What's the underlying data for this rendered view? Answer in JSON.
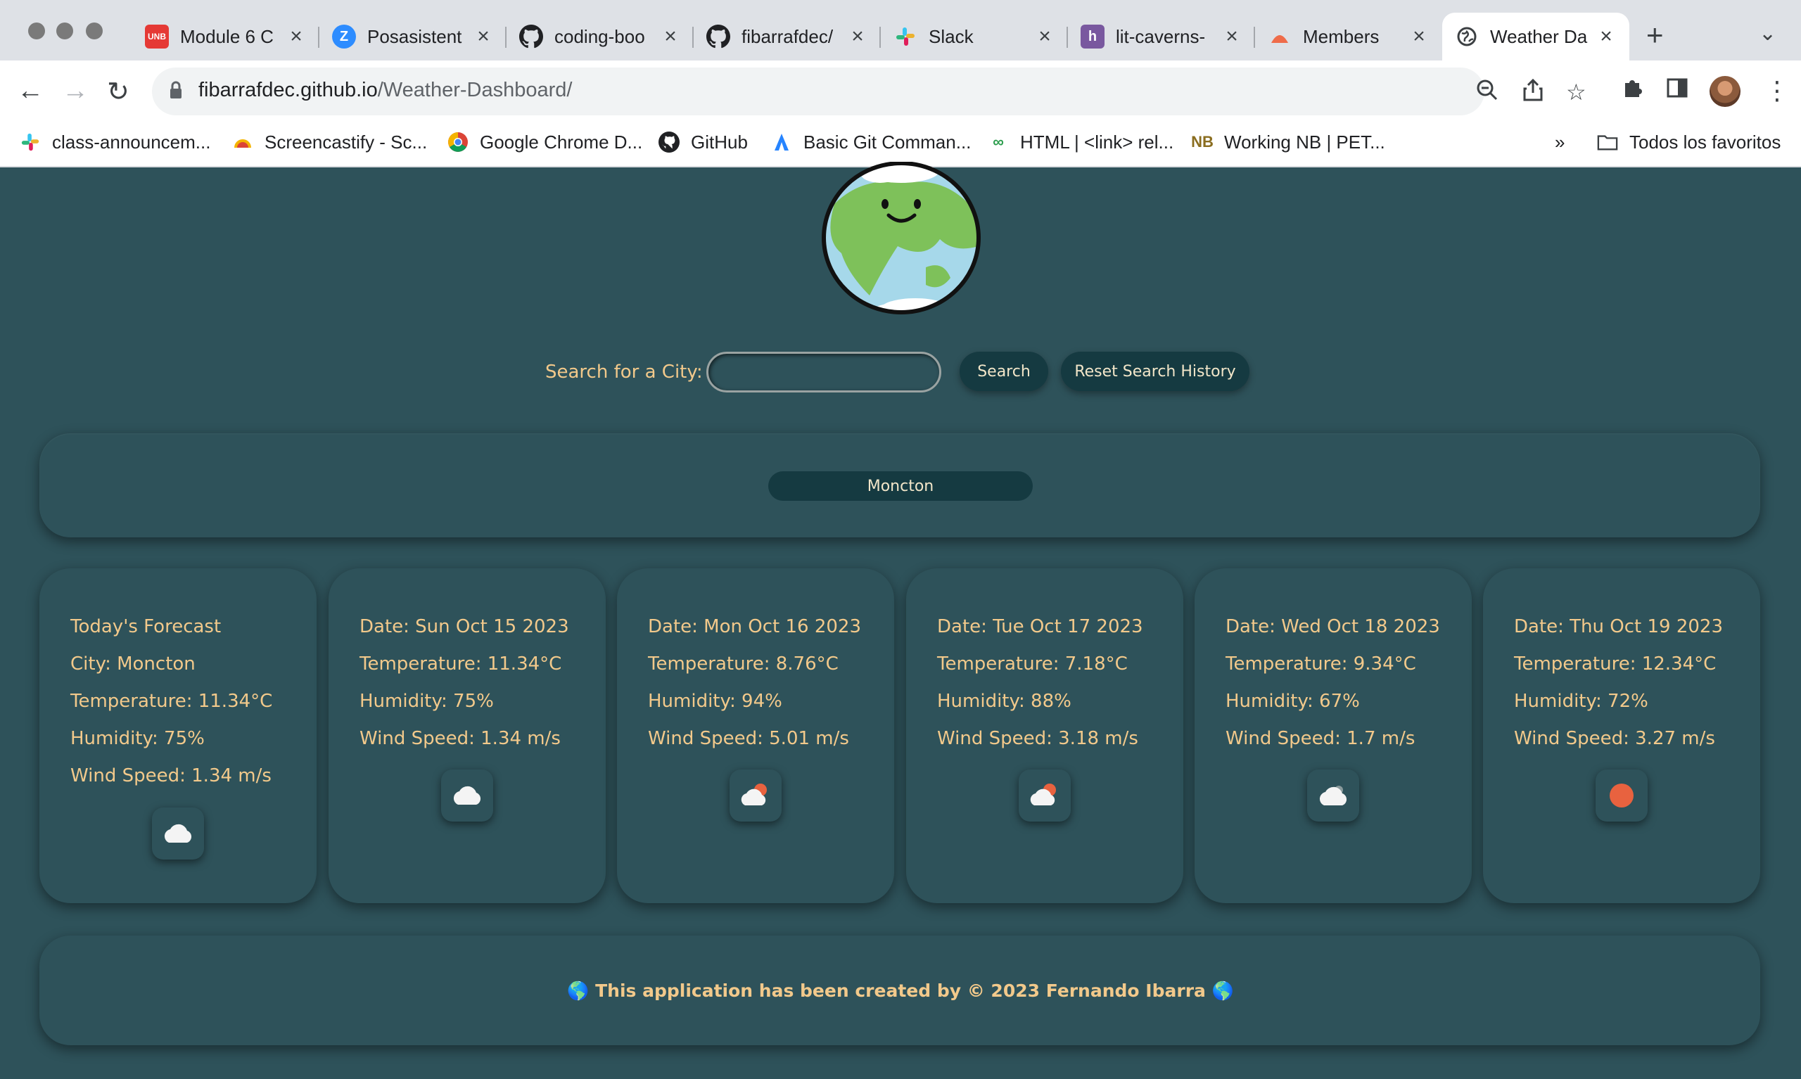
{
  "browser": {
    "tabs": [
      {
        "title": "Module 6 C",
        "favicon": "unb-icon"
      },
      {
        "title": "Posasistent",
        "favicon": "zoom-icon"
      },
      {
        "title": "coding-boo",
        "favicon": "github-icon"
      },
      {
        "title": "fibarrafdec/",
        "favicon": "github-icon"
      },
      {
        "title": "Slack",
        "favicon": "slack-icon"
      },
      {
        "title": "lit-caverns-",
        "favicon": "heroku-icon"
      },
      {
        "title": "Members",
        "favicon": "members-icon"
      },
      {
        "title": "Weather Da",
        "favicon": "globe-icon"
      }
    ],
    "url_host": "fibarrafdec.github.io",
    "url_path": "/Weather-Dashboard/",
    "bookmarks": [
      {
        "label": "class-announcem...",
        "icon": "slack-icon"
      },
      {
        "label": "Screencastify - Sc...",
        "icon": "screencastify-icon"
      },
      {
        "label": "Google Chrome D...",
        "icon": "chrome-icon"
      },
      {
        "label": "GitHub",
        "icon": "github-icon"
      },
      {
        "label": "Basic Git Comman...",
        "icon": "atlassian-icon"
      },
      {
        "label": "HTML | <link> rel...",
        "icon": "link-icon"
      },
      {
        "label": "Working NB | PET...",
        "icon": "nb-icon"
      }
    ],
    "bookmarks_overflow": "»",
    "all_bookmarks": "Todos los favoritos"
  },
  "search": {
    "label": "Search for a City:",
    "input_value": "",
    "search_button": "Search",
    "reset_button": "Reset Search History"
  },
  "history": [
    "Moncton"
  ],
  "today": {
    "heading": "Today's Forecast",
    "city": "City: Moncton",
    "temperature": "Temperature: 11.34°C",
    "humidity": "Humidity: 75%",
    "wind": "Wind Speed: 1.34 m/s",
    "icon": "cloud-icon"
  },
  "forecast": [
    {
      "date": "Date: Sun Oct 15 2023",
      "temperature": "Temperature: 11.34°C",
      "humidity": "Humidity: 75%",
      "wind": "Wind Speed: 1.34 m/s",
      "icon": "cloud-icon"
    },
    {
      "date": "Date: Mon Oct 16 2023",
      "temperature": "Temperature: 8.76°C",
      "humidity": "Humidity: 94%",
      "wind": "Wind Speed: 5.01 m/s",
      "icon": "sun-cloud-icon"
    },
    {
      "date": "Date: Tue Oct 17 2023",
      "temperature": "Temperature: 7.18°C",
      "humidity": "Humidity: 88%",
      "wind": "Wind Speed: 3.18 m/s",
      "icon": "sun-cloud-icon"
    },
    {
      "date": "Date: Wed Oct 18 2023",
      "temperature": "Temperature: 9.34°C",
      "humidity": "Humidity: 67%",
      "wind": "Wind Speed: 1.7 m/s",
      "icon": "cloud-icon"
    },
    {
      "date": "Date: Thu Oct 19 2023",
      "temperature": "Temperature: 12.34°C",
      "humidity": "Humidity: 72%",
      "wind": "Wind Speed: 3.27 m/s",
      "icon": "sun-icon"
    }
  ],
  "footer": "🌎 This application has been created by © 2023 Fernando Ibarra 🌎",
  "colors": {
    "page_bg": "#2e525a",
    "text_accent": "#f2c98b",
    "button_bg": "#153a41",
    "sun": "#e8623f"
  }
}
